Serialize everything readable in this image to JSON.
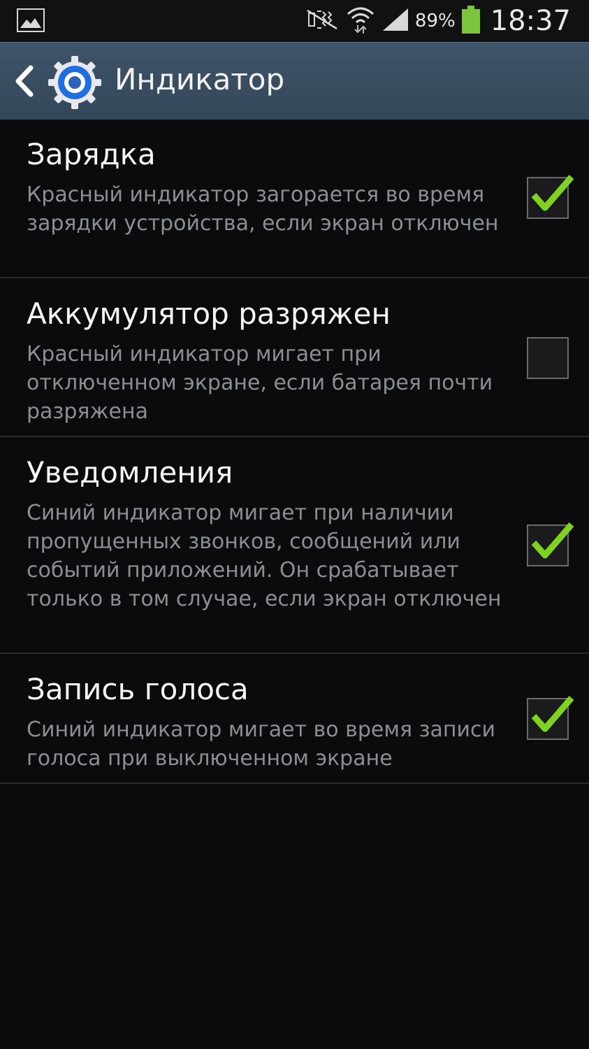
{
  "status_bar": {
    "battery_percent": "89%",
    "time": "18:37",
    "icons": [
      "gallery-icon",
      "silent-mode-icon",
      "wifi-icon",
      "signal-icon",
      "battery-icon"
    ],
    "battery_color": "#7bc53c"
  },
  "action_bar": {
    "title": "Индикатор",
    "icons": [
      "back-icon",
      "settings-gear-icon"
    ]
  },
  "settings": [
    {
      "label": "Зарядка",
      "description": "Красный индикатор загорается во время зарядки устройства, если экран отключен",
      "checked": true
    },
    {
      "label": "Аккумулятор разряжен",
      "description": "Красный индикатор мигает при отключенном экране, если батарея почти разряжена",
      "checked": false
    },
    {
      "label": "Уведомления",
      "description": "Синий индикатор мигает при наличии пропущенных звонков, сообщений или событий приложений. Он срабатывает только в том случае, если экран отключен",
      "checked": true
    },
    {
      "label": "Запись голоса",
      "description": "Синий индикатор мигает во время записи голоса при выключенном экране",
      "checked": true
    }
  ],
  "colors": {
    "checkmark": "#7ed321",
    "action_bar": "#3f5469",
    "background": "#0b0b0d"
  }
}
